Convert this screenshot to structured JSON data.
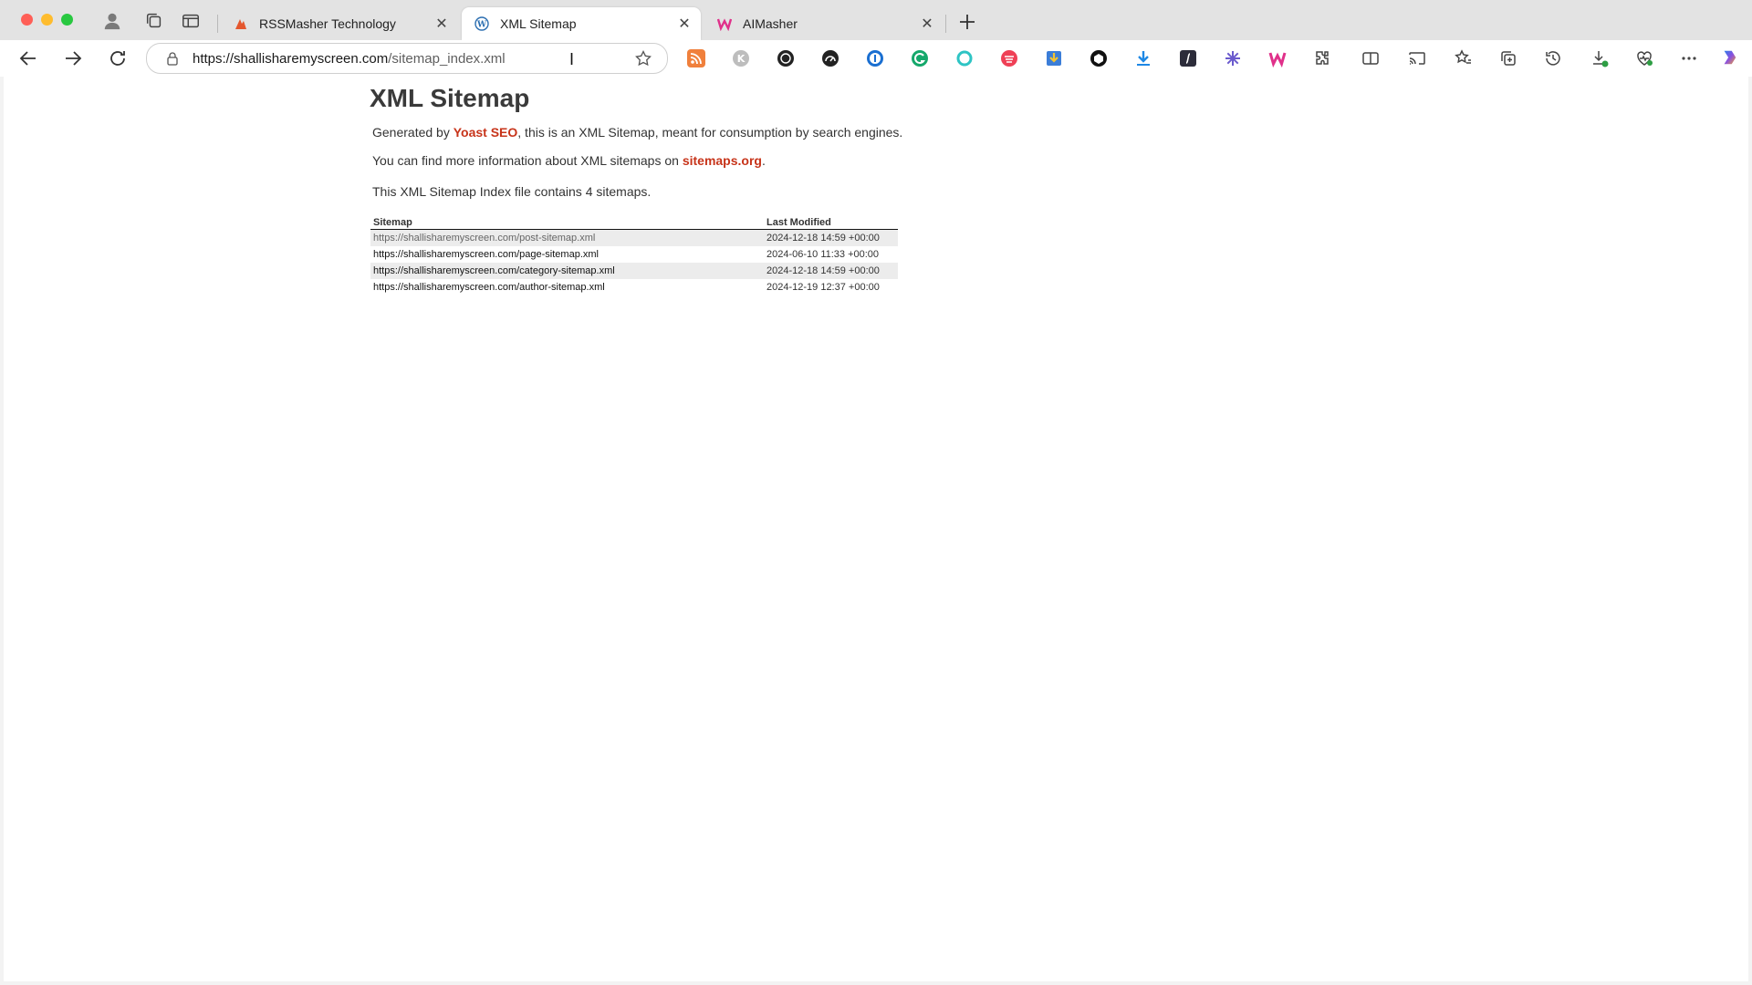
{
  "tabs": [
    {
      "title": "RSSMasher Technology",
      "active": false,
      "favicon": "rssmasher-icon"
    },
    {
      "title": "XML Sitemap",
      "active": true,
      "favicon": "wordpress-icon"
    },
    {
      "title": "AIMasher",
      "active": false,
      "favicon": "aimasher-icon"
    }
  ],
  "toolbar": {
    "url_host": "https://shallisharemyscreen.com",
    "url_path": "/sitemap_index.xml"
  },
  "extensions": [
    "rss-icon",
    "k-icon",
    "globe-icon",
    "speedometer-icon",
    "password-icon",
    "grammarly-icon",
    "circle-icon",
    "pocket-icon",
    "download-box-icon",
    "cube-icon",
    "download-arrow-icon",
    "script-icon",
    "sparkle-icon",
    "aimasher-icon",
    "puzzle-icon",
    "split-screen-icon",
    "cast-icon",
    "favorites-icon",
    "collections-icon",
    "history-icon",
    "downloads-icon",
    "health-icon",
    "more-icon",
    "copilot-icon"
  ],
  "page": {
    "heading": "XML Sitemap",
    "intro_prefix": "Generated by ",
    "intro_link": "Yoast SEO",
    "intro_suffix": ", this is an XML Sitemap, meant for consumption by search engines.",
    "more_prefix": "You can find more information about XML sitemaps on ",
    "more_link": "sitemaps.org",
    "more_suffix": ".",
    "count_text": "This XML Sitemap Index file contains 4 sitemaps.",
    "table": {
      "headers": [
        "Sitemap",
        "Last Modified"
      ],
      "rows": [
        {
          "url": "https://shallisharemyscreen.com/post-sitemap.xml",
          "modified": "2024-12-18 14:59 +00:00"
        },
        {
          "url": "https://shallisharemyscreen.com/page-sitemap.xml",
          "modified": "2024-06-10 11:33 +00:00"
        },
        {
          "url": "https://shallisharemyscreen.com/category-sitemap.xml",
          "modified": "2024-12-18 14:59 +00:00"
        },
        {
          "url": "https://shallisharemyscreen.com/author-sitemap.xml",
          "modified": "2024-12-19 12:37 +00:00"
        }
      ]
    }
  },
  "colors": {
    "link_accent": "#c7341a",
    "row_stripe": "#ececec"
  }
}
